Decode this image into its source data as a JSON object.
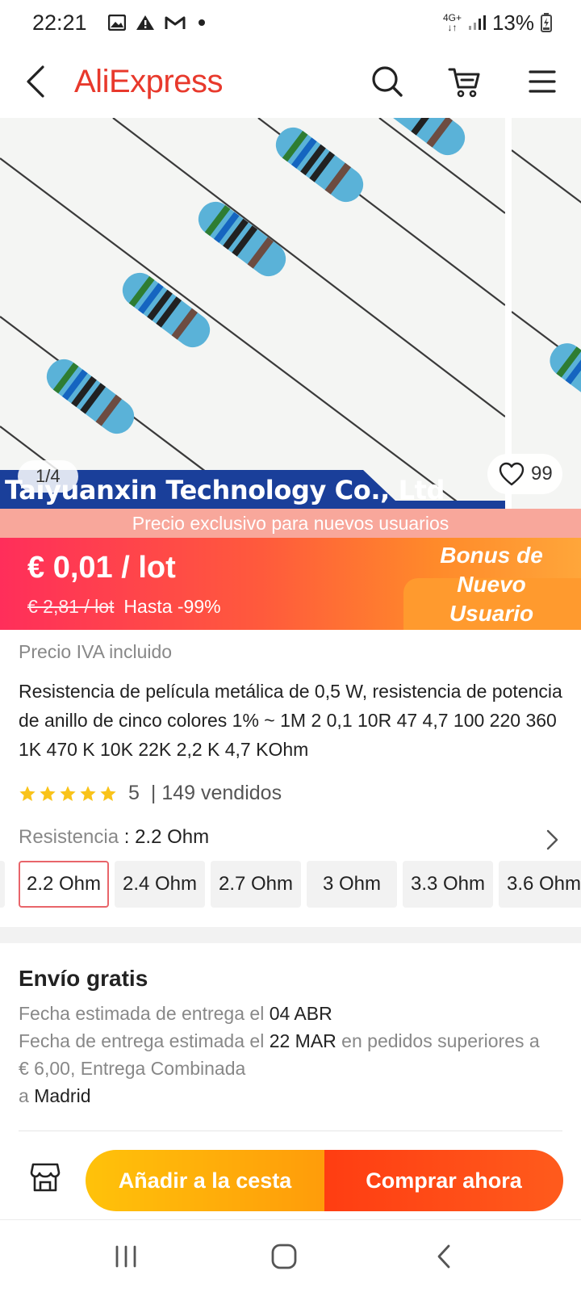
{
  "status_bar": {
    "time": "22:21",
    "network": "4G+",
    "battery": "13%"
  },
  "header": {
    "logo": "AliExpress"
  },
  "gallery": {
    "watermark": "Taiyuanxin Technology Co., Ltd",
    "counter": "1/4",
    "wishlist_count": "99"
  },
  "promo": {
    "strip": "Precio exclusivo para nuevos usuarios",
    "price": "€ 0,01 / lot",
    "original_price": "€ 2,81 / lot",
    "discount": "Hasta -99%",
    "bonus_line1": "Bonus de",
    "bonus_line2": "Nuevo",
    "bonus_line3": "Usuario"
  },
  "product": {
    "tax_note": "Precio IVA incluido",
    "title": "Resistencia de película metálica de 0,5 W, resistencia de potencia de anillo de cinco colores 1% ~ 1M 2 0,1 10R 47 4,7 100 220 360 1K 470 K 10K 22K 2,2 K 4,7 KOhm",
    "rating": "5",
    "sold": "| 149 vendidos",
    "rating_stars": 5
  },
  "variant": {
    "label": "Resistencia",
    "sep": " : ",
    "selected": "2.2 Ohm",
    "options": [
      "2.2 Ohm",
      "2.4 Ohm",
      "2.7 Ohm",
      "3 Ohm",
      "3.3 Ohm",
      "3.6 Ohm"
    ]
  },
  "shipping": {
    "title": "Envío gratis",
    "line1_prefix": "Fecha estimada de entrega el ",
    "line1_date": "04 ABR",
    "line2_prefix": "Fecha de entrega estimada el ",
    "line2_date": "22 MAR",
    "line2_suffix": " en pedidos superiores a",
    "line3": "€ 6,00, Entrega Combinada",
    "line4_prefix": "a ",
    "line4_city": "Madrid"
  },
  "actions": {
    "add_to_cart": "Añadir a la cesta",
    "buy_now": "Comprar ahora"
  },
  "colors": {
    "brand": "#e8392c",
    "price_gradient_start": "#ff2e5a",
    "price_gradient_end": "#ffa63a",
    "cart_button": "#ffb10a",
    "buy_button": "#ff4515",
    "selected_chip_border": "#e8656a"
  },
  "icons": [
    "gallery-icon",
    "alert-icon",
    "gmail-icon",
    "signal-icon",
    "battery-icon",
    "back-arrow-icon",
    "search-icon",
    "cart-icon",
    "menu-icon",
    "heart-icon",
    "star-icon",
    "chevron-right-icon",
    "store-icon",
    "recent-apps-icon",
    "home-icon",
    "nav-back-icon"
  ]
}
